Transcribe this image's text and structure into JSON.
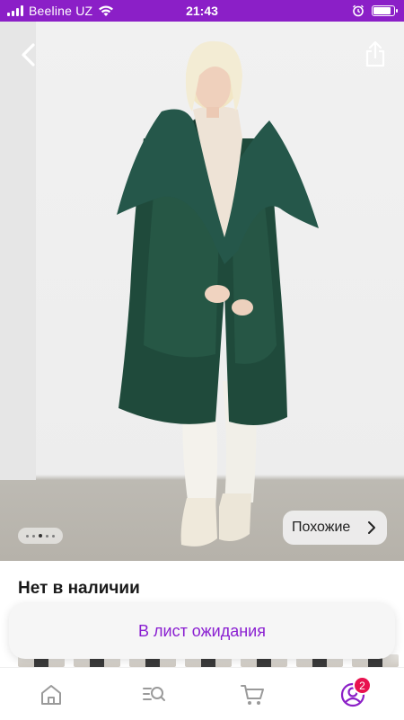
{
  "status_bar": {
    "carrier": "Beeline UZ",
    "time": "21:43",
    "battery_level": 0.85
  },
  "product": {
    "gallery": {
      "image_description_icon": "product-photo",
      "page_count": 5,
      "active_page": 3
    },
    "similar_label": "Похожие",
    "stock_status": "Нет в наличии",
    "waitlist_label": "В лист ожидания"
  },
  "bottom_nav": {
    "items": [
      "home-icon",
      "catalog-search-icon",
      "cart-icon",
      "profile-icon"
    ],
    "profile_badge": "2"
  },
  "colors": {
    "brand": "#8b1fc7",
    "button_text": "#8a1fd1",
    "badge": "#e8124f"
  }
}
